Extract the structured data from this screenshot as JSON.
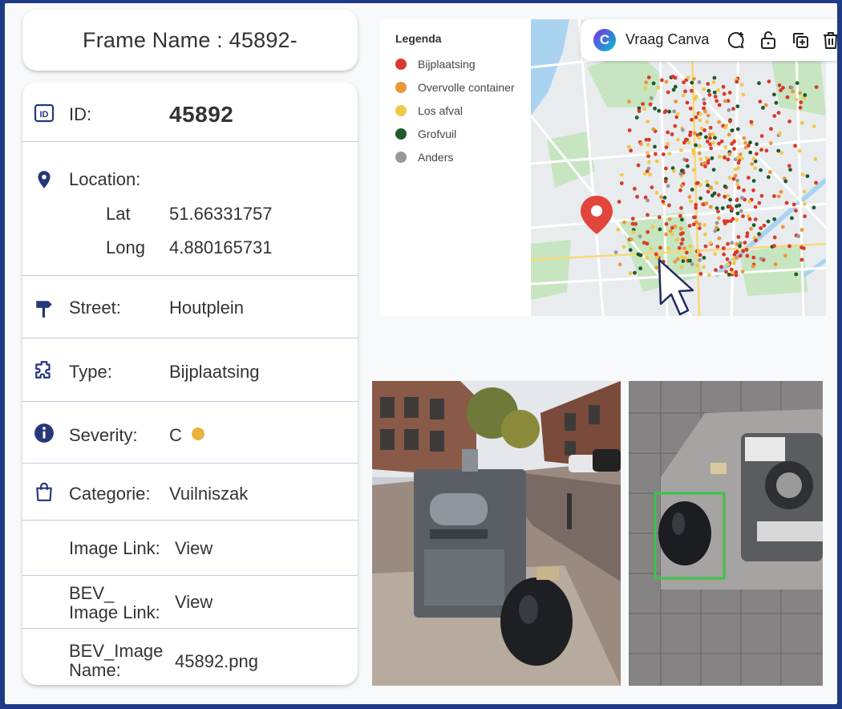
{
  "frame": {
    "title": "Frame Name : 45892-"
  },
  "info": {
    "id_label": "ID:",
    "id_value": "45892",
    "location_label": "Location:",
    "lat_label": "Lat",
    "lat_value": "51.66331757",
    "long_label": "Long",
    "long_value": "4.880165731",
    "street_label": "Street:",
    "street_value": "Houtplein",
    "type_label": "Type:",
    "type_value": "Bijplaatsing",
    "severity_label": "Severity:",
    "severity_value": "C",
    "severity_color": "#e6b53a",
    "categorie_label": "Categorie:",
    "categorie_value": "Vuilniszak",
    "image_link_label": "Image Link:",
    "image_link_value": "View",
    "bev_link_label_1": "BEV_",
    "bev_link_label_2": "Image Link:",
    "bev_link_value": "View",
    "bev_name_label_1": "BEV_Image",
    "bev_name_label_2": "Name:",
    "bev_name_value": "45892.png"
  },
  "legend": {
    "title": "Legenda",
    "items": [
      {
        "label": "Bijplaatsing",
        "color": "#d93a2b"
      },
      {
        "label": "Overvolle container",
        "color": "#e8973a"
      },
      {
        "label": "Los afval",
        "color": "#f0c94a"
      },
      {
        "label": "Grofvuil",
        "color": "#1f5a2a"
      },
      {
        "label": "Anders",
        "color": "#999999"
      }
    ]
  },
  "toolbar": {
    "logo_letter": "C",
    "ask_canva_label": "Vraag Canva"
  },
  "icons": {
    "id": "id-card-icon",
    "location": "location-pin-icon",
    "street": "signpost-icon",
    "type": "puzzle-icon",
    "severity": "info-icon",
    "categorie": "bag-icon",
    "comment": "add-comment-icon",
    "lock": "unlock-icon",
    "duplicate": "duplicate-icon",
    "delete": "trash-icon",
    "cursor": "cursor-icon"
  }
}
